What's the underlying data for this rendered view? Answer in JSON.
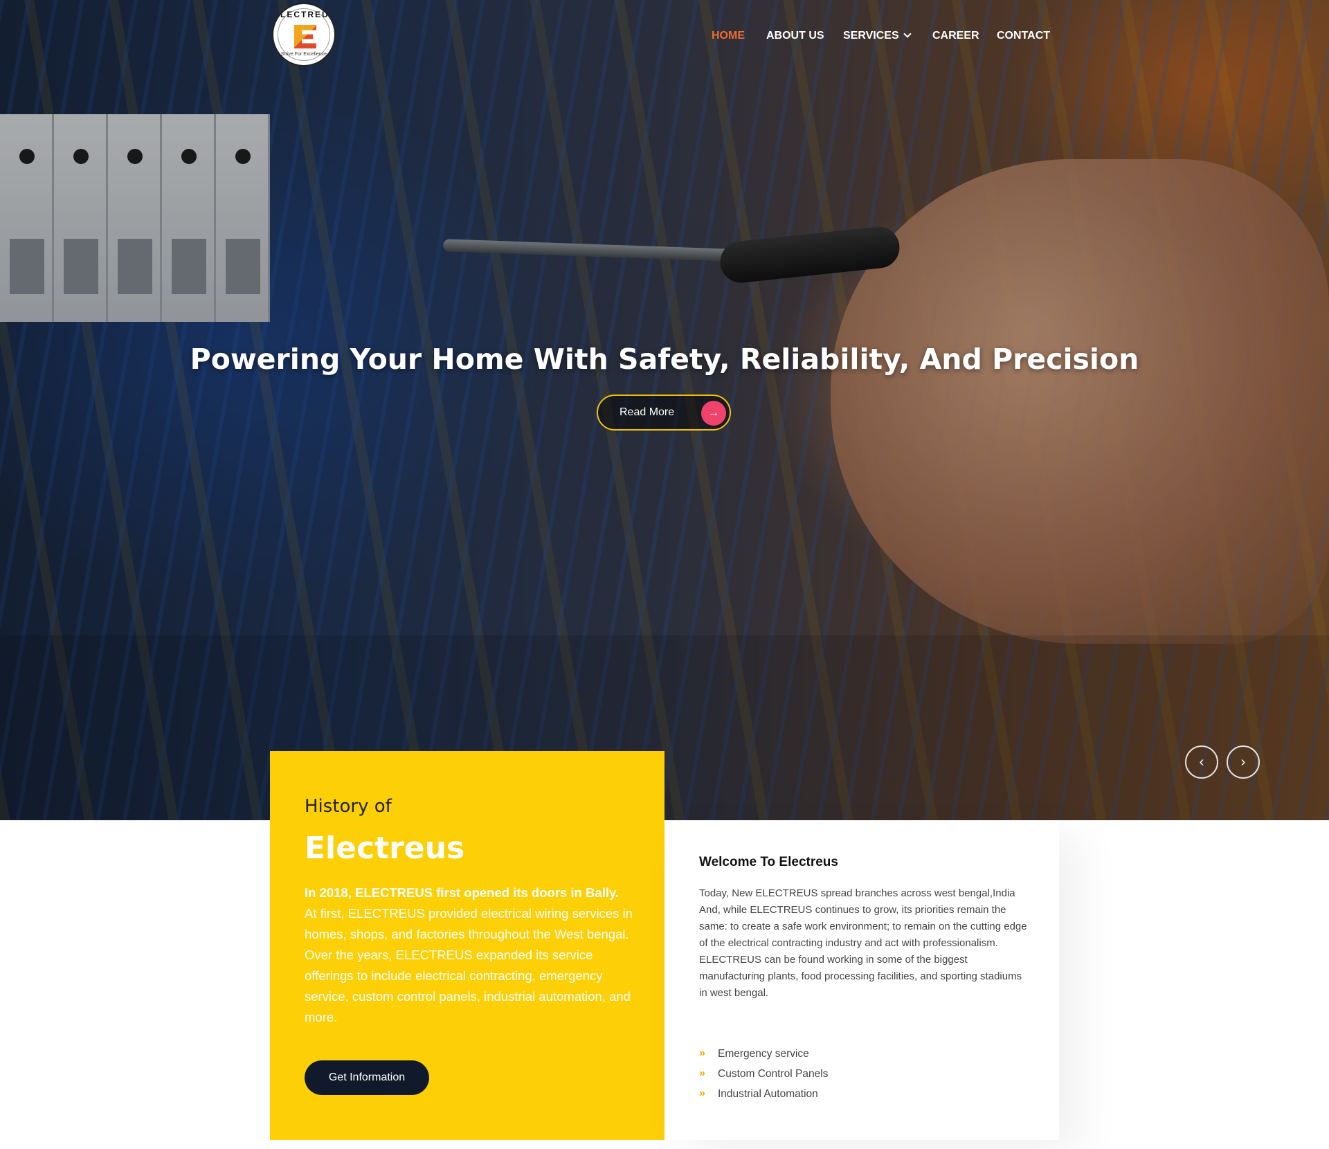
{
  "brand": {
    "name": "ELECTREUS",
    "tagline": "Strive For Excellence"
  },
  "nav": {
    "items": [
      {
        "label": "HOME",
        "active": true
      },
      {
        "label": "ABOUT US",
        "active": false
      },
      {
        "label": "SERVICES",
        "active": false
      },
      {
        "label": "CAREER",
        "active": false
      },
      {
        "label": "CONTACT",
        "active": false
      }
    ]
  },
  "hero": {
    "title": "Powering Your Home With Safety, Reliability, And Precision",
    "button_label": "Read More",
    "prev_icon": "chevron-left-icon",
    "next_icon": "chevron-right-icon"
  },
  "history": {
    "pre_title": "History of",
    "title": "Electreus",
    "lead": "In 2018, ELECTREUS first opened its doors in Bally.",
    "body": "At first, ELECTREUS provided electrical wiring services in homes, shops, and factories throughout the West bengal. Over the years, ELECTREUS expanded its service offerings to include electrical contracting, emergency service, custom control panels, industrial automation, and more.",
    "button_label": "Get Information"
  },
  "welcome": {
    "title": "Welcome To Electreus",
    "body": "Today, New ELECTREUS spread branches across west bengal,India And, while ELECTREUS continues to grow, its priorities remain the same: to create a safe work environment; to remain on the cutting edge of the electrical contracting industry and act with professionalism. ELECTREUS can be found working in some of the biggest manufacturing plants, food processing facilities, and sporting stadiums in west bengal.",
    "list": [
      "Emergency service",
      "Custom Control Panels",
      "Industrial Automation"
    ],
    "list_icon": "double-chevron-right-icon"
  },
  "colors": {
    "accent_orange": "#f36c2b",
    "yellow": "#fccf07",
    "pink": "#f0436b",
    "navy": "#111a2b"
  }
}
